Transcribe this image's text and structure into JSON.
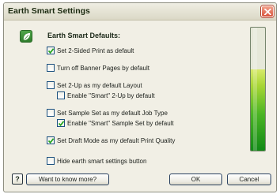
{
  "window": {
    "title": "Earth Smart Settings",
    "close_icon": "close-icon"
  },
  "section": {
    "heading": "Earth Smart Defaults:",
    "icon": "leaf-icon"
  },
  "options": [
    {
      "id": "two-sided",
      "label": "Set 2-Sided Print as default",
      "checked": true
    },
    {
      "id": "banner-pages",
      "label": "Turn off Banner Pages by default",
      "checked": false
    },
    {
      "id": "two-up",
      "label": "Set 2-Up as my default Layout",
      "checked": false
    },
    {
      "id": "smart-two-up",
      "label": "Enable \"Smart\" 2-Up by default",
      "checked": false
    },
    {
      "id": "sample-set",
      "label": "Set Sample Set as my default Job Type",
      "checked": false
    },
    {
      "id": "smart-sample-set",
      "label": "Enable \"Smart\" Sample Set by default",
      "checked": true
    },
    {
      "id": "draft-mode",
      "label": "Set Draft Mode as my default Print Quality",
      "checked": true
    },
    {
      "id": "hide-button",
      "label": "Hide earth smart settings button",
      "checked": false
    }
  ],
  "gauge": {
    "level": 0.66,
    "colors": {
      "low": "#118a15",
      "mid": "#4bb524",
      "high": "#d7ea6a"
    }
  },
  "footer": {
    "help_label": "?",
    "more_label": "Want to know more?",
    "ok_label": "OK",
    "cancel_label": "Cancel"
  },
  "colors": {
    "dialog_bg": "#f1efe5",
    "close_red": "#d8523a",
    "checkbox_border": "#1c5180",
    "check_green": "#23a41d"
  }
}
